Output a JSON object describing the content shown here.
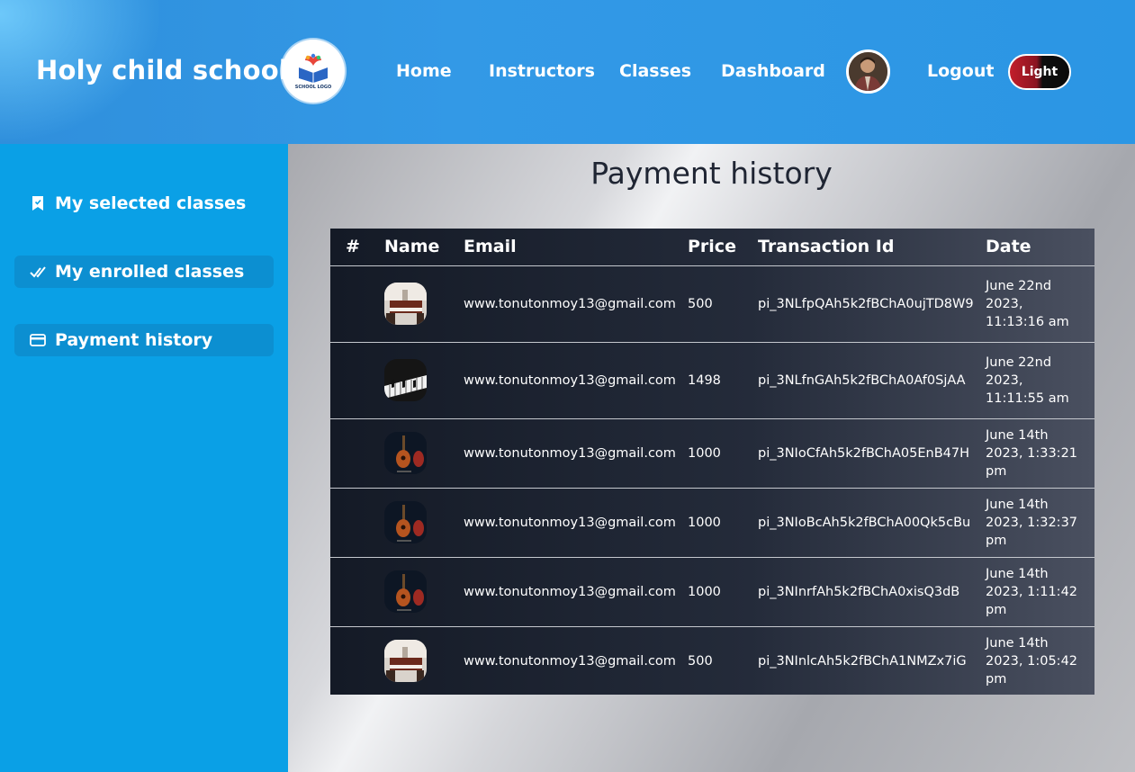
{
  "header": {
    "brand": "Holy child school",
    "logo_text": "SCHOOL LOGO",
    "nav": [
      "Home",
      "Instructors",
      "Classes",
      "Dashboard"
    ],
    "logout": "Logout",
    "theme_toggle": "Light"
  },
  "sidebar": {
    "items": [
      {
        "label": "My selected classes",
        "icon": "bookmark-icon",
        "active": false
      },
      {
        "label": "My enrolled classes",
        "icon": "double-check-icon",
        "active": true
      },
      {
        "label": "Payment history",
        "icon": "credit-card-icon",
        "active": true
      }
    ]
  },
  "main": {
    "title": "Payment history",
    "columns": [
      "#",
      "Name",
      "Email",
      "Price",
      "Transaction Id",
      "Date"
    ],
    "rows": [
      {
        "thumb": "piano-room",
        "email": "www.tonutonmoy13@gmail.com",
        "price": "500",
        "tx": "pi_3NLfpQAh5k2fBChA0ujTD8W9",
        "date": "June 22nd 2023, 11:13:16 am"
      },
      {
        "thumb": "piano-keys",
        "email": "www.tonutonmoy13@gmail.com",
        "price": "1498",
        "tx": "pi_3NLfnGAh5k2fBChA0Af0SjAA",
        "date": "June 22nd 2023, 11:11:55 am"
      },
      {
        "thumb": "guitar",
        "email": "www.tonutonmoy13@gmail.com",
        "price": "1000",
        "tx": "pi_3NIoCfAh5k2fBChA05EnB47H",
        "date": "June 14th 2023, 1:33:21 pm"
      },
      {
        "thumb": "guitar",
        "email": "www.tonutonmoy13@gmail.com",
        "price": "1000",
        "tx": "pi_3NIoBcAh5k2fBChA00Qk5cBu",
        "date": "June 14th 2023, 1:32:37 pm"
      },
      {
        "thumb": "guitar",
        "email": "www.tonutonmoy13@gmail.com",
        "price": "1000",
        "tx": "pi_3NInrfAh5k2fBChA0xisQ3dB",
        "date": "June 14th 2023, 1:11:42 pm"
      },
      {
        "thumb": "piano-room",
        "email": "www.tonutonmoy13@gmail.com",
        "price": "500",
        "tx": "pi_3NInlcAh5k2fBChA1NMZx7iG",
        "date": "June 14th 2023, 1:05:42 pm"
      }
    ]
  }
}
